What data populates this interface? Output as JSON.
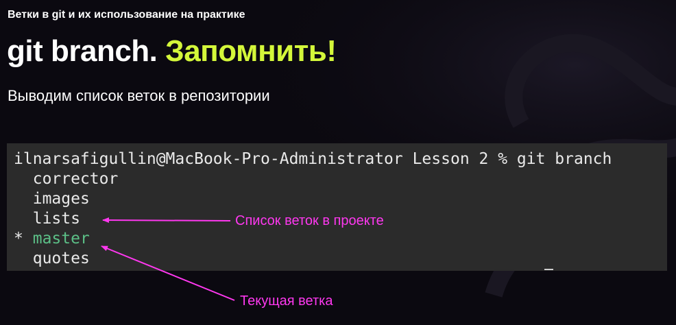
{
  "header": {
    "subtitle": "Ветки в git и их использование на практике",
    "title_main": "git branch.",
    "title_accent": "Запомнить!",
    "description": "Выводим список веток в репозитории"
  },
  "terminal": {
    "prompt": "ilnarsafigullin@MacBook-Pro-Administrator Lesson 2 % git branch",
    "branches": [
      {
        "marker": " ",
        "name": "corrector"
      },
      {
        "marker": " ",
        "name": "images"
      },
      {
        "marker": " ",
        "name": "lists"
      },
      {
        "marker": "*",
        "name": "master"
      },
      {
        "marker": " ",
        "name": "quotes"
      }
    ]
  },
  "annotations": {
    "branch_list": "Список веток в проекте",
    "current_branch": "Текущая ветка"
  },
  "colors": {
    "accent": "#d4f73a",
    "annotation": "#ff38f0",
    "current_branch": "#5cc087",
    "terminal_bg": "#2b2b2b"
  }
}
